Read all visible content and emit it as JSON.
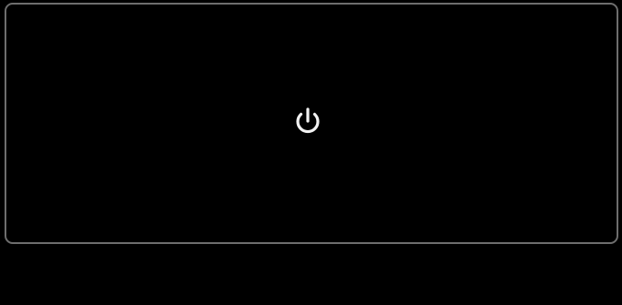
{
  "screen": {
    "background": "#000000",
    "panel_border_color": "#6e6e6e"
  },
  "power": {
    "icon": "power-icon",
    "icon_color": "#f2f2f2"
  }
}
